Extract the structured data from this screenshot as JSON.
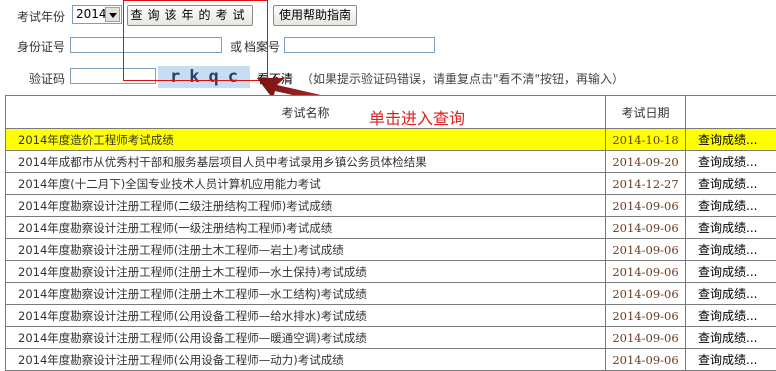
{
  "form": {
    "year_label": "考试年份",
    "year_value": "2014",
    "query_button": "查询该年的考试",
    "help_button": "使用帮助指南",
    "id_label": "身份证号",
    "or_label": "或",
    "archive_label": "档案号",
    "captcha_label": "验证码",
    "captcha_text": "rkqc",
    "refresh_link": "看不清",
    "hint": "（如果提示验证码错误，请重复点击\"看不清\"按钮，再输入）"
  },
  "annotation": {
    "text": "单击进入查询",
    "color": "#e02020"
  },
  "table": {
    "headers": [
      "考试名称",
      "考试日期",
      ""
    ],
    "highlight_color": "#ffff00",
    "rows": [
      {
        "name": "2014年度造价工程师考试成绩",
        "date": "2014-10-18",
        "action": "查询成绩...",
        "highlight": true
      },
      {
        "name": "2014年成都市从优秀村干部和服务基层项目人员中考试录用乡镇公务员体检结果",
        "date": "2014-09-20",
        "action": "查询成绩..."
      },
      {
        "name": "2014年度(十二月下)全国专业技术人员计算机应用能力考试",
        "date": "2014-12-27",
        "action": "查询成绩..."
      },
      {
        "name": "2014年度勘察设计注册工程师(二级注册结构工程师)考试成绩",
        "date": "2014-09-06",
        "action": "查询成绩..."
      },
      {
        "name": "2014年度勘察设计注册工程师(一级注册结构工程师)考试成绩",
        "date": "2014-09-06",
        "action": "查询成绩..."
      },
      {
        "name": "2014年度勘察设计注册工程师(注册土木工程师—岩土)考试成绩",
        "date": "2014-09-06",
        "action": "查询成绩..."
      },
      {
        "name": "2014年度勘察设计注册工程师(注册土木工程师—水土保持)考试成绩",
        "date": "2014-09-06",
        "action": "查询成绩..."
      },
      {
        "name": "2014年度勘察设计注册工程师(注册土木工程师—水工结构)考试成绩",
        "date": "2014-09-06",
        "action": "查询成绩..."
      },
      {
        "name": "2014年度勘察设计注册工程师(公用设备工程师—给水排水)考试成绩",
        "date": "2014-09-06",
        "action": "查询成绩..."
      },
      {
        "name": "2014年度勘察设计注册工程师(公用设备工程师—暖通空调)考试成绩",
        "date": "2014-09-06",
        "action": "查询成绩..."
      },
      {
        "name": "2014年度勘察设计注册工程师(公用设备工程师—动力)考试成绩",
        "date": "2014-09-06",
        "action": "查询成绩..."
      }
    ]
  }
}
